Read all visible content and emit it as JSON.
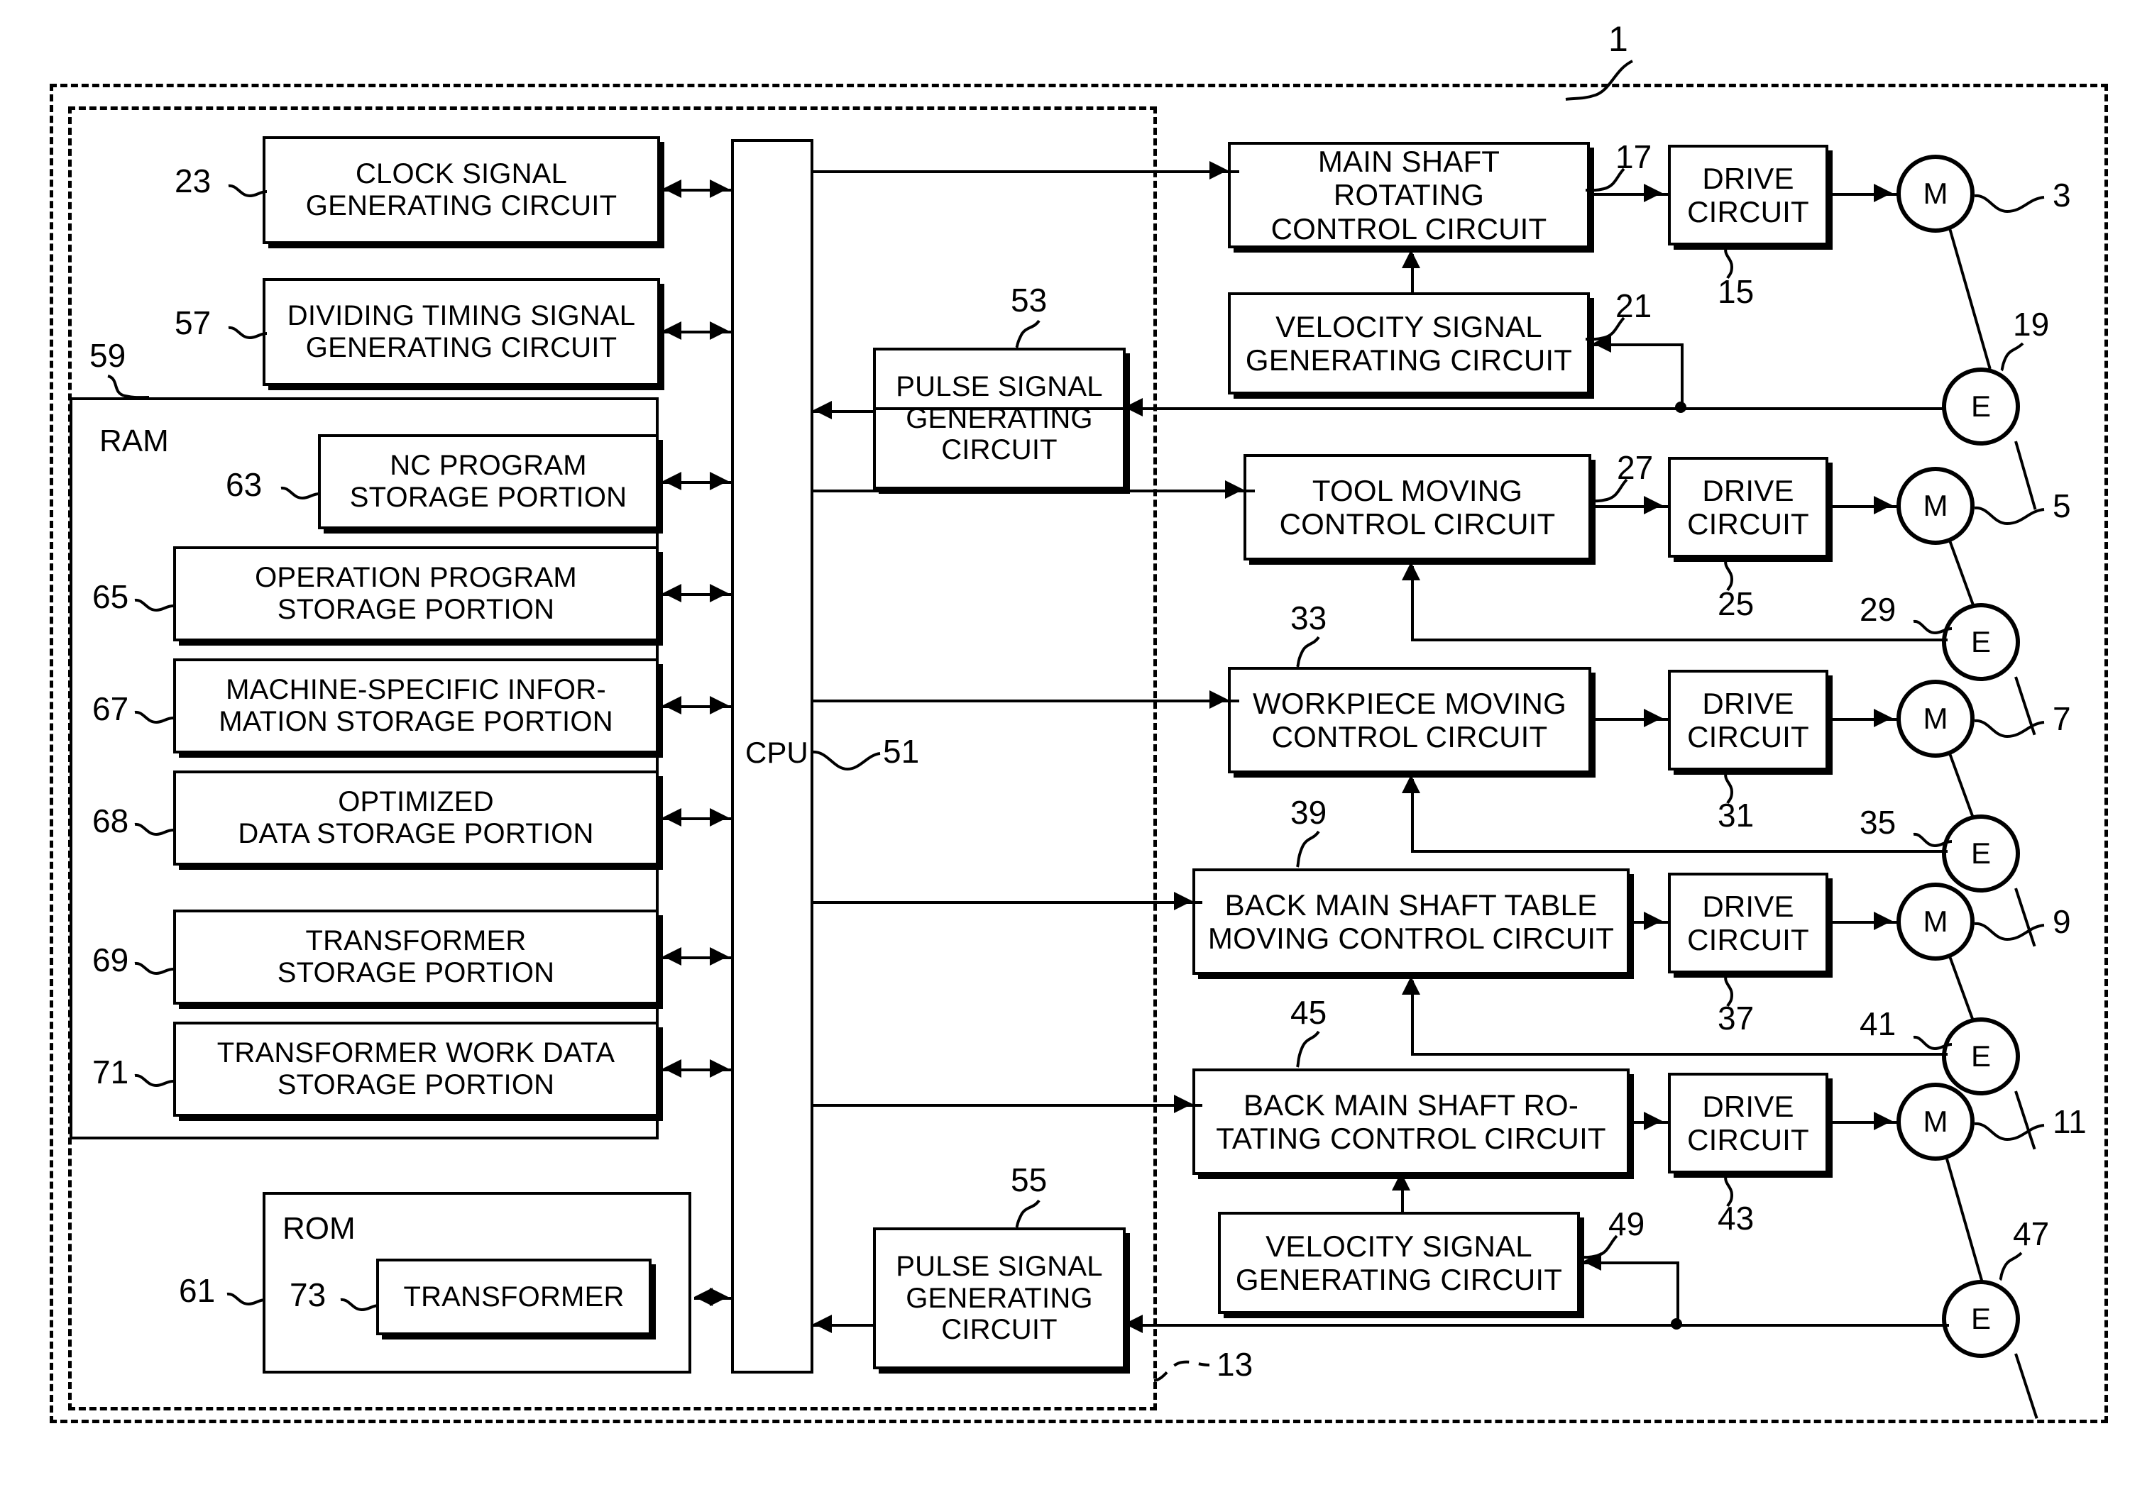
{
  "figure": {
    "id_label": "1",
    "cpu_label": "CPU",
    "cpu_ref": "51",
    "nc_unit_ref": "13",
    "ram_label": "RAM",
    "ram_ref": "59",
    "rom_label": "ROM",
    "rom_ref": "61"
  },
  "left_column": [
    {
      "ref": "23",
      "lines": [
        "CLOCK SIGNAL",
        "GENERATING CIRCUIT"
      ]
    },
    {
      "ref": "57",
      "lines": [
        "DIVIDING TIMING SIGNAL",
        "GENERATING CIRCUIT"
      ]
    }
  ],
  "ram_items": [
    {
      "ref": "63",
      "lines": [
        "NC PROGRAM",
        "STORAGE PORTION"
      ]
    },
    {
      "ref": "65",
      "lines": [
        "OPERATION PROGRAM",
        "STORAGE PORTION"
      ]
    },
    {
      "ref": "67",
      "lines": [
        "MACHINE-SPECIFIC INFOR-",
        "MATION STORAGE PORTION"
      ]
    },
    {
      "ref": "68",
      "lines": [
        "OPTIMIZED",
        "DATA STORAGE PORTION"
      ]
    },
    {
      "ref": "69",
      "lines": [
        "TRANSFORMER",
        "STORAGE PORTION"
      ]
    },
    {
      "ref": "71",
      "lines": [
        "TRANSFORMER WORK DATA",
        "STORAGE PORTION"
      ]
    }
  ],
  "rom_items": [
    {
      "ref": "73",
      "lines": [
        "TRANSFORMER"
      ]
    }
  ],
  "pulse_circuits": [
    {
      "ref": "53",
      "lines": [
        "PULSE SIGNAL",
        "GENERATING",
        "CIRCUIT"
      ]
    },
    {
      "ref": "55",
      "lines": [
        "PULSE SIGNAL",
        "GENERATING",
        "CIRCUIT"
      ]
    }
  ],
  "control_rows": [
    {
      "control": {
        "ref": "17",
        "lines": [
          "MAIN SHAFT ROTATING",
          "CONTROL CIRCUIT"
        ]
      },
      "drive": {
        "ref": "15",
        "lines": [
          "DRIVE",
          "CIRCUIT"
        ]
      },
      "motor": {
        "ref": "3",
        "glyph": "M"
      },
      "encoder": {
        "ref": "19",
        "glyph": "E"
      },
      "feedback": {
        "ref": "21",
        "lines": [
          "VELOCITY SIGNAL",
          "GENERATING CIRCUIT"
        ]
      }
    },
    {
      "control": {
        "ref": "27",
        "lines": [
          "TOOL MOVING",
          "CONTROL CIRCUIT"
        ]
      },
      "drive": {
        "ref": "25",
        "lines": [
          "DRIVE",
          "CIRCUIT"
        ]
      },
      "motor": {
        "ref": "5",
        "glyph": "M"
      },
      "encoder": {
        "ref": "29",
        "glyph": "E"
      },
      "feedback": null
    },
    {
      "control": {
        "ref": "33",
        "lines": [
          "WORKPIECE MOVING",
          "CONTROL CIRCUIT"
        ]
      },
      "drive": {
        "ref": "31",
        "lines": [
          "DRIVE",
          "CIRCUIT"
        ]
      },
      "motor": {
        "ref": "7",
        "glyph": "M"
      },
      "encoder": {
        "ref": "35",
        "glyph": "E"
      },
      "feedback": null
    },
    {
      "control": {
        "ref": "39",
        "lines": [
          "BACK MAIN SHAFT TABLE",
          "MOVING CONTROL CIRCUIT"
        ]
      },
      "drive": {
        "ref": "37",
        "lines": [
          "DRIVE",
          "CIRCUIT"
        ]
      },
      "motor": {
        "ref": "9",
        "glyph": "M"
      },
      "encoder": {
        "ref": "41",
        "glyph": "E"
      },
      "feedback": null
    },
    {
      "control": {
        "ref": "45",
        "lines": [
          "BACK MAIN SHAFT RO-",
          "TATING CONTROL CIRCUIT"
        ]
      },
      "drive": {
        "ref": "43",
        "lines": [
          "DRIVE",
          "CIRCUIT"
        ]
      },
      "motor": {
        "ref": "11",
        "glyph": "M"
      },
      "encoder": {
        "ref": "47",
        "glyph": "E"
      },
      "feedback": {
        "ref": "49",
        "lines": [
          "VELOCITY SIGNAL",
          "GENERATING CIRCUIT"
        ]
      }
    }
  ]
}
